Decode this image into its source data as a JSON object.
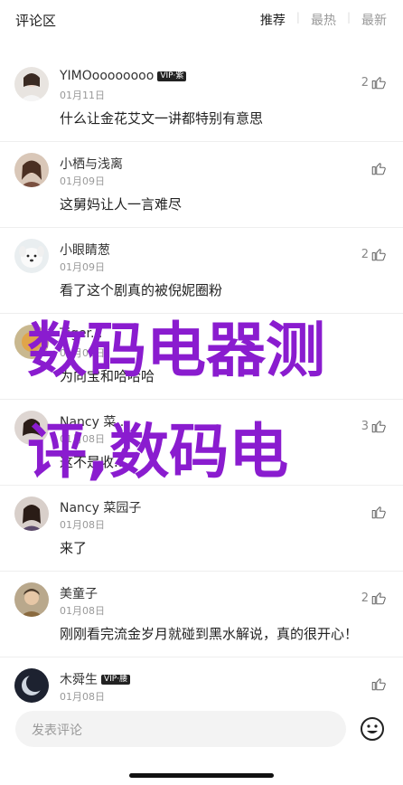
{
  "header": {
    "title": "评论区",
    "tabs": [
      "推荐",
      "最热",
      "最新"
    ]
  },
  "comments": [
    {
      "name": "YIMOoooooooo",
      "vip": "VIP·紫",
      "date": "01月11日",
      "text": "什么让金花艾文一讲都特别有意思",
      "likes": "2",
      "avatar": "avatar-girl"
    },
    {
      "name": "小栖与浅离",
      "vip": "",
      "date": "01月09日",
      "text": "这舅妈让人一言难尽",
      "likes": "",
      "avatar": "avatar-woman"
    },
    {
      "name": "小眼睛葱",
      "vip": "",
      "date": "01月09日",
      "text": "看了这个剧真的被倪妮圈粉",
      "likes": "2",
      "avatar": "avatar-dog"
    },
    {
      "name": "Tiger...",
      "vip": "",
      "date": "01月08日",
      "text": "为向宝和哈哈哈",
      "likes": "",
      "avatar": "avatar-tiger"
    },
    {
      "name": "Nancy 菜...",
      "vip": "",
      "date": "01月08日",
      "text": "这不是收...",
      "likes": "3",
      "avatar": "avatar-nancy1"
    },
    {
      "name": "Nancy 菜园子",
      "vip": "",
      "date": "01月08日",
      "text": "来了",
      "likes": "",
      "avatar": "avatar-nancy2"
    },
    {
      "name": "美童子",
      "vip": "",
      "date": "01月08日",
      "text": "刚刚看完流金岁月就碰到黑水解说，真的很开心！",
      "likes": "2",
      "avatar": "avatar-boy"
    },
    {
      "name": "木舜生",
      "vip": "VIP·腰",
      "date": "01月08日",
      "text": "",
      "likes": "",
      "avatar": "avatar-moon"
    }
  ],
  "overlay": {
    "line1": "数码电器测",
    "line2": "评,数码电"
  },
  "input": {
    "placeholder": "发表评论"
  },
  "colors": {
    "overlay": "#8a1ccf",
    "text": "#222222",
    "muted": "#999999"
  }
}
